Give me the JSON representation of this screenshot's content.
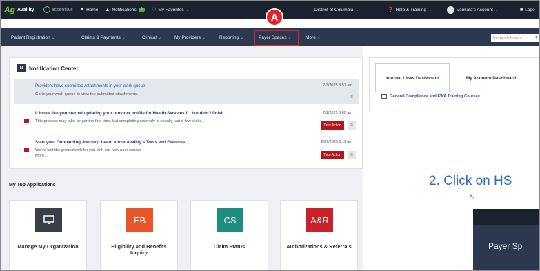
{
  "topbar": {
    "brand": "Availity",
    "essentials": "essentials",
    "home": "Home",
    "notifications": "Notifications",
    "notifications_count": "2",
    "favorites": "My Favorites",
    "region": "District of Columbia",
    "help": "Help & Training",
    "account": "Venkata's Account",
    "logout": "Logo"
  },
  "nav": {
    "items": [
      "Patient Registration",
      "Claims & Payments",
      "Clinical",
      "My Providers",
      "Reporting",
      "Payer Spaces",
      "More"
    ],
    "search_placeholder": "Keyword Search"
  },
  "annotation": {
    "marker": "A"
  },
  "notification_center": {
    "title": "Notification Center",
    "icon_letter": "N",
    "rows": [
      {
        "title": "Providers have submitted Attachments in your work queue.",
        "body": "Go to your work queue to view the submitted attachments.",
        "date": "7/3/2025 8:57 am"
      },
      {
        "title": "It looks like you started updating your provider profile for Health Services f... but didn't finish.",
        "body": "This process may take longer the first time, but completing quarterly is usually just a few clicks.",
        "date": "7/1/2025 3:00 am",
        "action": "Take Action"
      },
      {
        "title": "Start your Onboarding Journey: Learn about Availity's Tools and Features",
        "body": "We've laid the groundwork for you with our new user course",
        "more": "More...",
        "date": "6/27/2025 9:11 am",
        "action": "Take Action"
      }
    ]
  },
  "top_apps": {
    "title": "My Top Applications",
    "apps": [
      {
        "label": "Manage My Organization",
        "tile": "",
        "color": "#3a3f47"
      },
      {
        "label": "Eligibility and Benefits Inquiry",
        "tile": "EB",
        "color": "#e8562a"
      },
      {
        "label": "Claim Status",
        "tile": "CS",
        "color": "#1f8e7e"
      },
      {
        "label": "Authorizations & Referrals",
        "tile": "A&R",
        "color": "#c8222b"
      }
    ]
  },
  "right_panel": {
    "tabs": [
      "Internal Links Dashboard",
      "My Account Dashboard"
    ],
    "link": "General Compliance and FWA Training Courses"
  },
  "instruction": "2. Click on HS",
  "zoom_label": "Payer Sp",
  "colors": {
    "topbar": "#1a2230",
    "navbar": "#2b3850",
    "accent_red": "#e2212b",
    "link_blue": "#2a5aa8",
    "instruction_blue": "#2f6bc6"
  }
}
